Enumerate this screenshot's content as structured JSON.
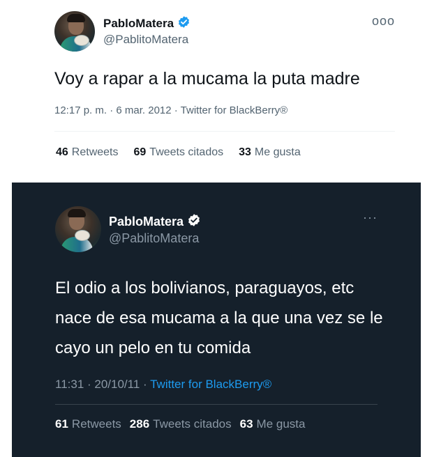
{
  "tweets": [
    {
      "theme": "light",
      "display_name": "PabloMatera",
      "handle": "@PablitoMatera",
      "verified": true,
      "verified_color": "#1d9bf0",
      "more_icon": "more-icon",
      "text": "Voy a rapar a la mucama la puta madre",
      "timestamp": "12:17 p. m. · 6 mar. 2012 · ",
      "source": "Twitter for BlackBerry®",
      "stats": [
        {
          "count": "46",
          "label": "Retweets"
        },
        {
          "count": "69",
          "label": "Tweets citados"
        },
        {
          "count": "33",
          "label": "Me gusta"
        }
      ]
    },
    {
      "theme": "dark",
      "display_name": "PabloMatera",
      "handle": "@PablitoMatera",
      "verified": true,
      "verified_color": "#ffffff",
      "more_icon": "more-icon",
      "text": "El odio a los bolivianos, paraguayos, etc nace de esa mucama a la que una vez se le cayo un pelo en tu comida",
      "timestamp": "11:31 · 20/10/11 · ",
      "source": "Twitter for BlackBerry®",
      "source_color": "#1d9bf0",
      "stats": [
        {
          "count": "61",
          "label": "Retweets"
        },
        {
          "count": "286",
          "label": "Tweets citados"
        },
        {
          "count": "63",
          "label": "Me gusta"
        }
      ]
    }
  ]
}
